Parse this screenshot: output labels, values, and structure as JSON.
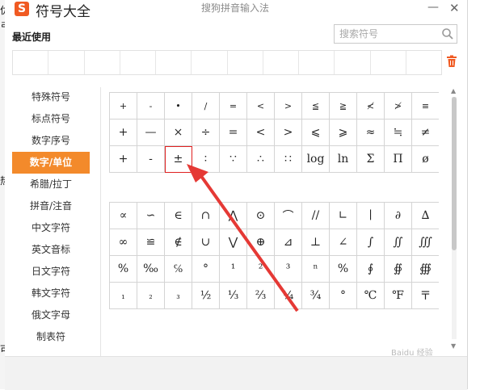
{
  "background_window": {
    "edge_chars": [
      "优",
      "ㄹ",
      "热",
      "可"
    ]
  },
  "window": {
    "logo_letter": "S",
    "title": "符号大全",
    "app_title": "搜狗拼音输入法",
    "minimize_glyph": "—",
    "close_glyph": "✕"
  },
  "recent": {
    "label": "最近使用",
    "cells": 12
  },
  "search": {
    "placeholder": "搜索符号"
  },
  "categories": [
    "特殊符号",
    "标点符号",
    "数字序号",
    "数字/单位",
    "希腊/拉丁",
    "拼音/注音",
    "中文字符",
    "英文音标",
    "日文字符",
    "韩文字符",
    "俄文字母",
    "制表符"
  ],
  "active_category_index": 3,
  "symbol_groups": [
    {
      "rows": [
        [
          "+",
          "-",
          "•",
          "/",
          "=",
          "<",
          ">",
          "≦",
          "≧",
          "≮",
          "≯",
          "≡"
        ],
        [
          "+",
          "—",
          "×",
          "÷",
          "=",
          "<",
          ">",
          "⩽",
          "⩾",
          "≈",
          "≒",
          "≠"
        ],
        [
          "+",
          "-",
          "±",
          "∶",
          "∵",
          "∴",
          "∷",
          "log",
          "ln",
          "Σ",
          "Π",
          "ø"
        ]
      ]
    },
    {
      "rows": [
        [
          "∝",
          "∽",
          "∈",
          "∩",
          "⋀",
          "⊙",
          "⌒",
          "//",
          "∟",
          "∣",
          "∂",
          "∆"
        ],
        [
          "∞",
          "≌",
          "∉",
          "∪",
          "⋁",
          "⊕",
          "⊿",
          "⊥",
          "∠",
          "∫",
          "∬",
          "∭"
        ],
        [
          "%",
          "‰",
          "℅",
          "°",
          "¹",
          "²",
          "³",
          "ⁿ",
          "%",
          "∮",
          "∯",
          "∰"
        ],
        [
          "₁",
          "₂",
          "₃",
          "½",
          "⅓",
          "⅔",
          "¼",
          "¾",
          "°",
          "℃",
          "℉",
          "〒"
        ]
      ]
    }
  ],
  "selected_symbol": "±",
  "watermark": "Baidu 经验",
  "colors": {
    "accent": "#f38a2b",
    "logo": "#f05a22",
    "selection": "#e02020",
    "arrow": "#e53935"
  }
}
